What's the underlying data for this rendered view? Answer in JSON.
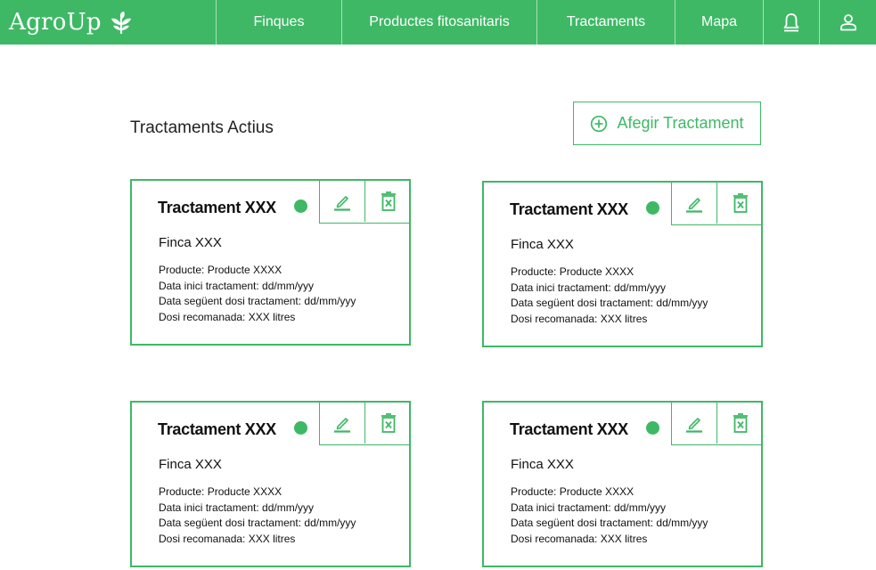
{
  "app": {
    "brand": "AgroUp"
  },
  "nav": {
    "items": [
      {
        "label": "Finques"
      },
      {
        "label": "Productes fitosanitaris"
      },
      {
        "label": "Tractaments"
      },
      {
        "label": "Mapa"
      }
    ],
    "icons": [
      "bell-icon",
      "user-icon"
    ]
  },
  "colors": {
    "accent": "#3fb866"
  },
  "main": {
    "title": "Tractaments Actius",
    "add_button": "Afegir Tractament"
  },
  "cards": [
    {
      "title": "Tractament XXX",
      "status": "active",
      "finca": "Finca XXX",
      "lines": [
        "Producte: Producte XXXX",
        "Data inici tractament: dd/mm/yyy",
        "Data següent dosi tractament: dd/mm/yyy",
        "Dosi recomanada: XXX litres"
      ]
    },
    {
      "title": "Tractament XXX",
      "status": "active",
      "finca": "Finca XXX",
      "lines": [
        "Producte: Producte XXXX",
        "Data inici tractament: dd/mm/yyy",
        "Data següent dosi tractament: dd/mm/yyy",
        "Dosi recomanada: XXX litres"
      ]
    },
    {
      "title": "Tractament XXX",
      "status": "active",
      "finca": "Finca XXX",
      "lines": [
        "Producte: Producte XXXX",
        "Data inici tractament: dd/mm/yyy",
        "Data següent dosi tractament: dd/mm/yyy",
        "Dosi recomanada: XXX litres"
      ]
    },
    {
      "title": "Tractament XXX",
      "status": "active",
      "finca": "Finca XXX",
      "lines": [
        "Producte: Producte XXXX",
        "Data inici tractament: dd/mm/yyy",
        "Data següent dosi tractament: dd/mm/yyy",
        "Dosi recomanada: XXX litres"
      ]
    }
  ]
}
